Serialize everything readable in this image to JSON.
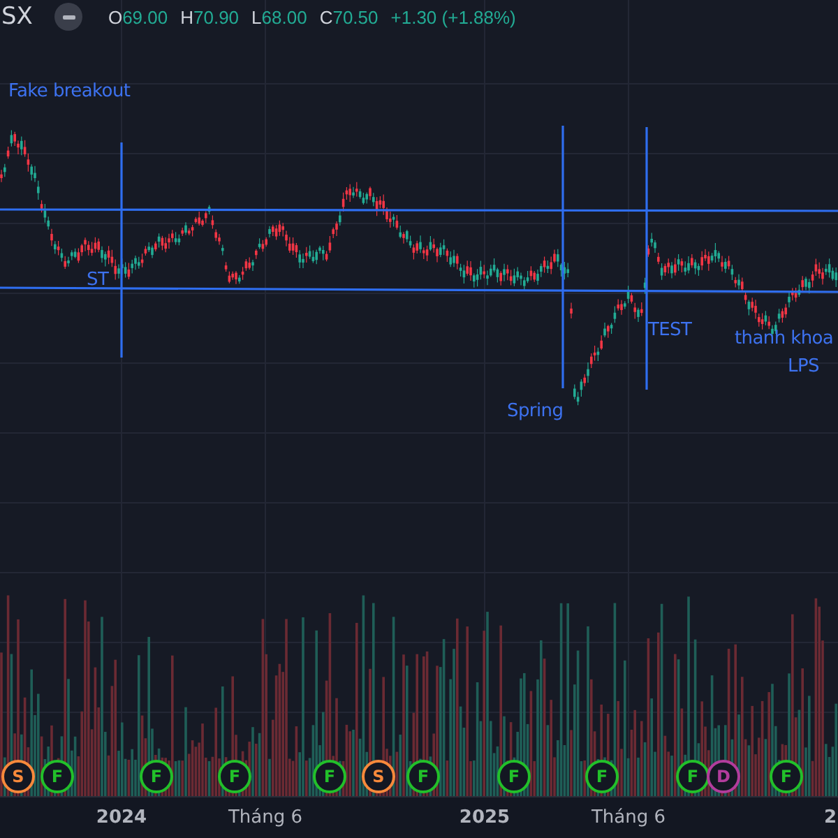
{
  "header": {
    "symbol": "SX",
    "ohlc": [
      {
        "label": "O",
        "value": "69.00"
      },
      {
        "label": "H",
        "value": "70.90"
      },
      {
        "label": "L",
        "value": "68.00"
      },
      {
        "label": "C",
        "value": "70.50"
      }
    ],
    "change": "+1.30 (+1.88%)"
  },
  "annotations": [
    {
      "text": "Fake breakout"
    },
    {
      "text": "ST"
    },
    {
      "text": "Spring"
    },
    {
      "text": "TEST"
    },
    {
      "text": "thanh khoa"
    },
    {
      "text": "LPS"
    }
  ],
  "events": [
    {
      "letter": "S",
      "color": "#f7893b"
    },
    {
      "letter": "F",
      "color": "#22c02a"
    },
    {
      "letter": "F",
      "color": "#22c02a"
    },
    {
      "letter": "F",
      "color": "#22c02a"
    },
    {
      "letter": "F",
      "color": "#22c02a"
    },
    {
      "letter": "S",
      "color": "#f7893b"
    },
    {
      "letter": "F",
      "color": "#22c02a"
    },
    {
      "letter": "F",
      "color": "#22c02a"
    },
    {
      "letter": "F",
      "color": "#22c02a"
    },
    {
      "letter": "F",
      "color": "#22c02a"
    },
    {
      "letter": "D",
      "color": "#b23c9c"
    },
    {
      "letter": "F",
      "color": "#22c02a"
    }
  ],
  "time_axis": [
    {
      "label": "2024",
      "kind": "year"
    },
    {
      "label": "Tháng 6",
      "kind": "month"
    },
    {
      "label": "2025",
      "kind": "year"
    },
    {
      "label": "Tháng 6",
      "kind": "month"
    },
    {
      "label": "2",
      "kind": "year"
    }
  ]
}
